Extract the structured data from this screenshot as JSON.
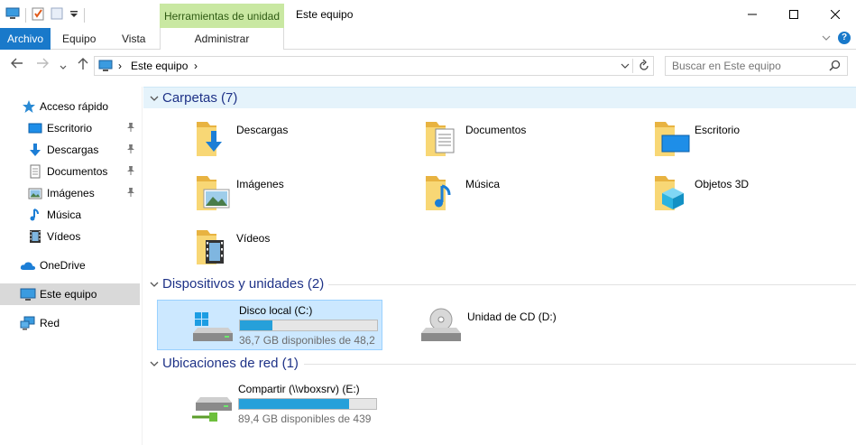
{
  "titlebar": {
    "context_tab_group": "Herramientas de unidad",
    "window_title": "Este equipo"
  },
  "ribbon": {
    "tabs": [
      "Archivo",
      "Equipo",
      "Vista"
    ],
    "context_tab": "Administrar"
  },
  "address": {
    "crumb": "Este equipo",
    "search_placeholder": "Buscar en Este equipo"
  },
  "sidebar": {
    "quick_access": "Acceso rápido",
    "items": [
      {
        "label": "Escritorio",
        "icon": "desktop-icon",
        "pinned": true
      },
      {
        "label": "Descargas",
        "icon": "download-icon",
        "pinned": true
      },
      {
        "label": "Documentos",
        "icon": "document-icon",
        "pinned": true
      },
      {
        "label": "Imágenes",
        "icon": "pictures-icon",
        "pinned": true
      },
      {
        "label": "Música",
        "icon": "music-icon",
        "pinned": false
      },
      {
        "label": "Vídeos",
        "icon": "videos-icon",
        "pinned": false
      }
    ],
    "onedrive": "OneDrive",
    "this_pc": "Este equipo",
    "network": "Red"
  },
  "groups": {
    "folders": "Carpetas (7)",
    "devices": "Dispositivos y unidades (2)",
    "network": "Ubicaciones de red (1)"
  },
  "folders": [
    {
      "label": "Descargas",
      "icon": "downloads-folder-icon"
    },
    {
      "label": "Documentos",
      "icon": "documents-folder-icon"
    },
    {
      "label": "Escritorio",
      "icon": "desktop-folder-icon"
    },
    {
      "label": "Imágenes",
      "icon": "pictures-folder-icon"
    },
    {
      "label": "Música",
      "icon": "music-folder-icon"
    },
    {
      "label": "Objetos 3D",
      "icon": "3d-objects-folder-icon"
    },
    {
      "label": "Vídeos",
      "icon": "videos-folder-icon"
    }
  ],
  "drives": [
    {
      "name": "Disco local (C:)",
      "detail": "36,7 GB disponibles de 48,2",
      "used_fraction": 0.24
    },
    {
      "name": "Unidad de CD (D:)"
    }
  ],
  "network_locations": [
    {
      "name": "Compartir (\\\\vboxsrv) (E:)",
      "detail": "89,4 GB disponibles de 439",
      "used_fraction": 0.8
    }
  ],
  "colors": {
    "accent": "#1979ca",
    "context_tab": "#c9e8a2",
    "group_title": "#1e3287",
    "selection": "#cce8ff",
    "capacity_bar": "#26a0da"
  }
}
